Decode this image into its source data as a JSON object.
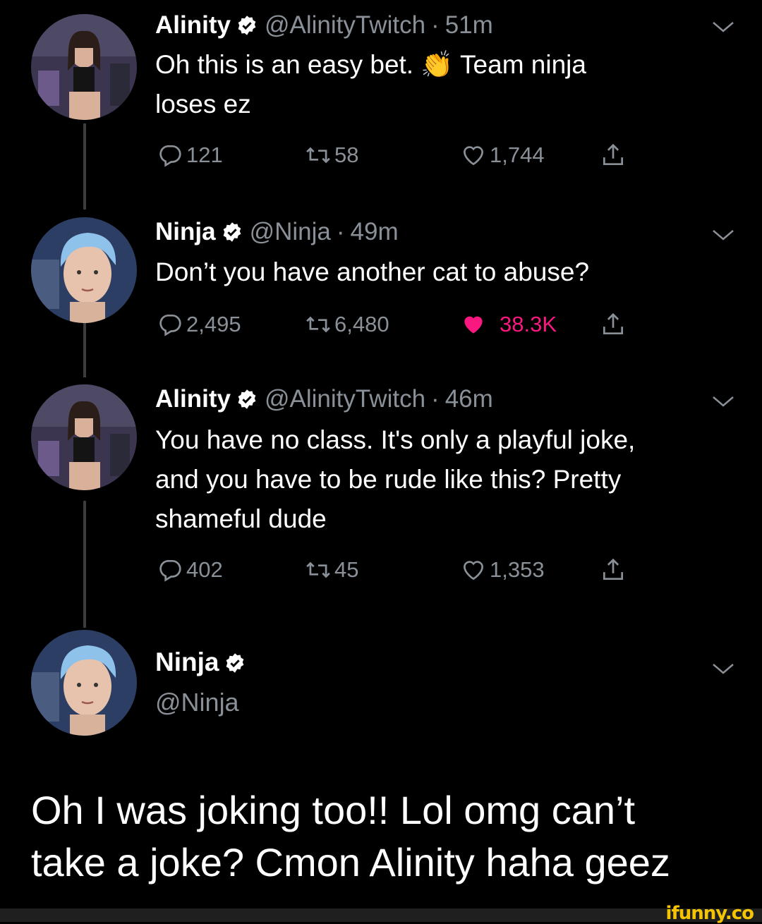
{
  "tweets": [
    {
      "name": "Alinity",
      "handle": "@AlinityTwitch",
      "separator": "·",
      "time": "51m",
      "text_line1": "Oh this is an easy bet. 👏 Team ninja",
      "text_line2": "loses ez",
      "replies": "121",
      "retweets": "58",
      "likes": "1,744",
      "liked": false
    },
    {
      "name": "Ninja",
      "handle": "@Ninja",
      "separator": "·",
      "time": "49m",
      "text_line1": "Don’t you have another cat to abuse?",
      "replies": "2,495",
      "retweets": "6,480",
      "likes": "38.3K",
      "liked": true
    },
    {
      "name": "Alinity",
      "handle": "@AlinityTwitch",
      "separator": "·",
      "time": "46m",
      "text_line1": "You have no class. It's only a playful joke,",
      "text_line2": "and you have to be rude like this? Pretty",
      "text_line3": "shameful dude",
      "replies": "402",
      "retweets": "45",
      "likes": "1,353",
      "liked": false
    }
  ],
  "main_tweet": {
    "name": "Ninja",
    "handle": "@Ninja",
    "text_line1": "Oh I was joking too!! Lol omg can’t",
    "text_line2": "take a joke? Cmon Alinity haha geez"
  },
  "watermark": "ifunny.co",
  "colors": {
    "background": "#000000",
    "muted_text": "#8a9097",
    "like_pink": "#f91880",
    "verified_badge": "#ffffff",
    "watermark_yellow": "#f5c400"
  },
  "icons": [
    "reply-icon",
    "retweet-icon",
    "like-icon",
    "share-icon",
    "verified-icon",
    "chevron-down-icon"
  ]
}
